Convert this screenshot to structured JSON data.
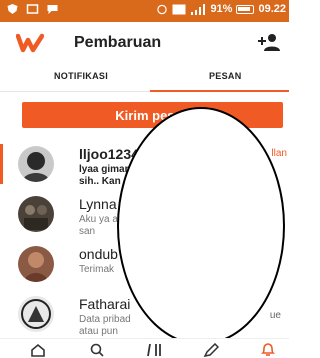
{
  "status_bar": {
    "battery": "91%",
    "time": "09.22"
  },
  "header": {
    "title": "Pembaruan",
    "logo_icon": "wattpad-logo",
    "add_user_icon": "add-person-icon"
  },
  "tabs": [
    {
      "label": "NOTIFIKASI",
      "active": false
    },
    {
      "label": "PESAN",
      "active": true
    }
  ],
  "send_button": {
    "label": "Kirim pesan"
  },
  "messages": [
    {
      "name": "lljoo1234",
      "preview": "lyaa gimana sih.. Kan",
      "meta": "llan",
      "unread": true
    },
    {
      "name": "Lynna",
      "preview": "Aku ya aja, san",
      "meta": "",
      "unread": false
    },
    {
      "name": "ondub",
      "preview": "Terimak",
      "meta": "",
      "unread": false
    },
    {
      "name": "Fatharai",
      "preview": "Data pribad atau pun diliba",
      "meta2": "ue",
      "unread": false
    }
  ],
  "bottom_nav": [
    "home-icon",
    "search-icon",
    "library-icon",
    "write-icon",
    "notifications-icon"
  ],
  "colors": {
    "accent": "#f05a24",
    "status_bar": "#d96a1c"
  }
}
